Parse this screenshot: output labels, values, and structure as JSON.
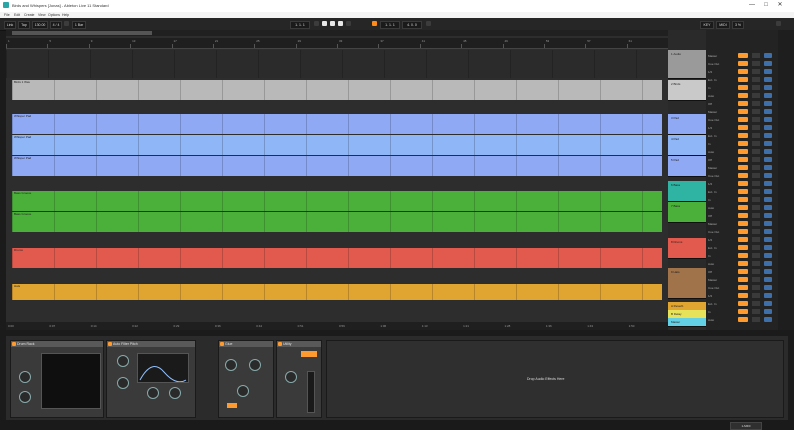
{
  "window": {
    "title": "Birds and Whispers [Jonas] - Ableton Live 11 Standard",
    "minimize": "—",
    "maximize": "□",
    "close": "✕"
  },
  "menu": [
    "File",
    "Edit",
    "Create",
    "View",
    "Options",
    "Help"
  ],
  "transport": {
    "link": "Link",
    "tap": "Tap",
    "tempo": "130.00",
    "time_sig": "4 / 4",
    "metro": "1 Bar",
    "position": "1.  1.  1",
    "loop_start": "1.  1.  1",
    "loop_length": "4.  0.  0",
    "key": "KEY",
    "midi": "MIDI",
    "cpu": "3 %"
  },
  "ruler": {
    "bars": [
      "1",
      "5",
      "9",
      "13",
      "17",
      "21",
      "25",
      "29",
      "33",
      "37",
      "41",
      "45",
      "49",
      "53",
      "57",
      "61"
    ],
    "times": [
      "0:00",
      "0:07",
      "0:14",
      "0:22",
      "0:29",
      "0:36",
      "0:44",
      "0:51",
      "0:59",
      "1:06",
      "1:13",
      "1:21",
      "1:28",
      "1:36",
      "1:43",
      "1:50"
    ]
  },
  "clips": [
    {
      "name": "Birds 1 Wav",
      "color": "#b9b9b9"
    },
    {
      "name": "Whisper Pad",
      "color": "#8fa9f5"
    },
    {
      "name": "Whisper Pad",
      "color": "#8fb6f7"
    },
    {
      "name": "Whisper Pad",
      "color": "#8fa9f5"
    },
    {
      "name": "Bass Groove",
      "color": "#4bb03a"
    },
    {
      "name": "Bass Groove",
      "color": "#4bb03a"
    },
    {
      "name": "Drums",
      "color": "#e25a4d"
    },
    {
      "name": "Hats",
      "color": "#e0a430"
    }
  ],
  "tracks": [
    {
      "name": "1 Audio",
      "color": "#9a9a9a"
    },
    {
      "name": "2 Birds",
      "color": "#c9c9c9"
    },
    {
      "name": "3 Pad",
      "color": "#8fa9f5"
    },
    {
      "name": "4 Pad",
      "color": "#8fb6f7"
    },
    {
      "name": "5 Pad",
      "color": "#8fa9f5"
    },
    {
      "name": "6 Bass",
      "color": "#2fb3a3"
    },
    {
      "name": "7 Bass",
      "color": "#4bb03a"
    },
    {
      "name": "8 Drums",
      "color": "#e25a4d"
    },
    {
      "name": "9 Hats",
      "color": "#a0734a"
    },
    {
      "name": "A Reverb",
      "color": "#e0a430"
    },
    {
      "name": "B Delay",
      "color": "#e6e35a"
    },
    {
      "name": "Master",
      "color": "#64d0e6"
    }
  ],
  "mixer": {
    "labels": [
      "Master",
      "Cue Out",
      "1/2",
      "Ext. In",
      "In",
      "Auto",
      "Off"
    ],
    "button": "S",
    "vol": "0"
  },
  "devices": [
    {
      "title": "Drum Rack"
    },
    {
      "title": "Auto Filter Pitch"
    },
    {
      "title": "Glue"
    },
    {
      "title": "Utility"
    }
  ],
  "drop_message": "Drop Audio Effects Here",
  "status": {
    "left": "",
    "right": "1-MIDI"
  }
}
